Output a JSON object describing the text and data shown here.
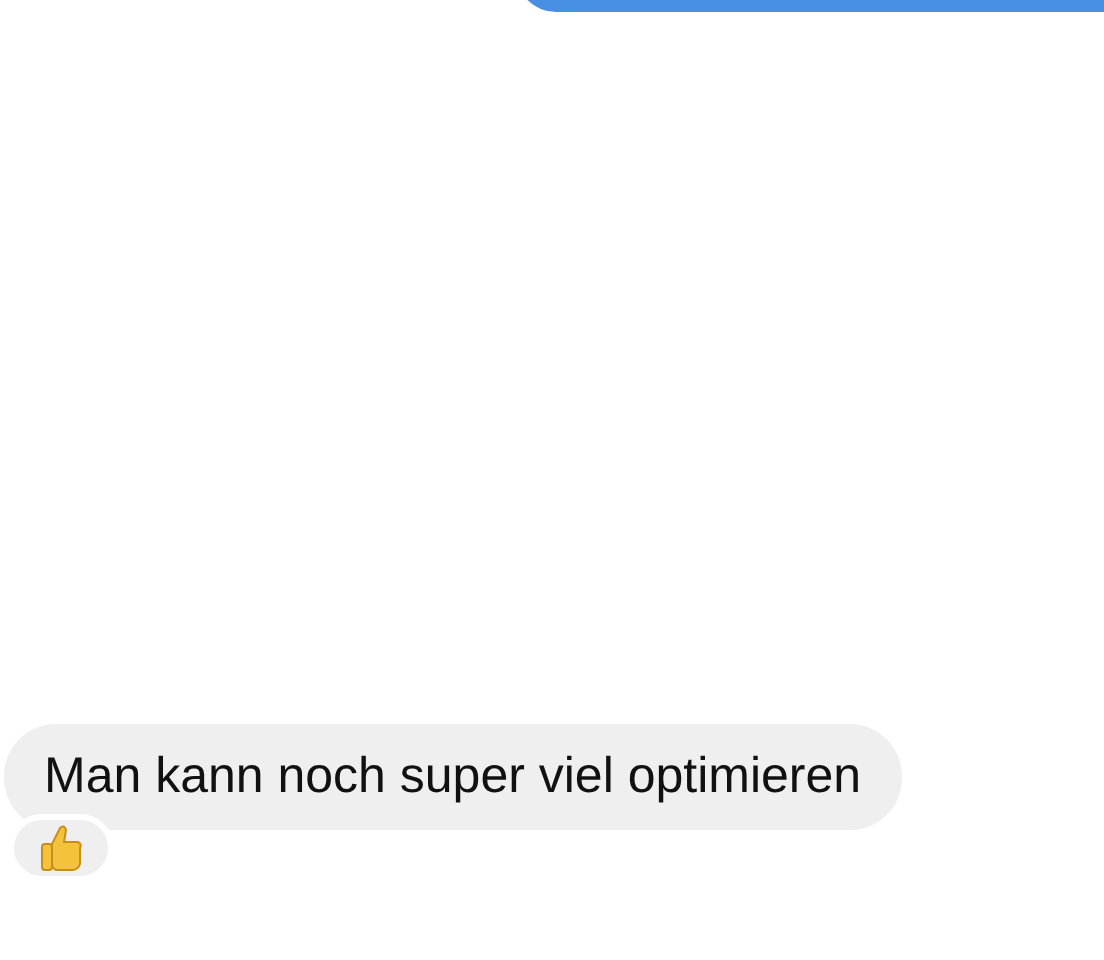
{
  "messages": [
    {
      "kind": "outgoing"
    },
    {
      "kind": "incoming",
      "text": "Man kann noch super viel optimieren",
      "reacted": true
    }
  ]
}
